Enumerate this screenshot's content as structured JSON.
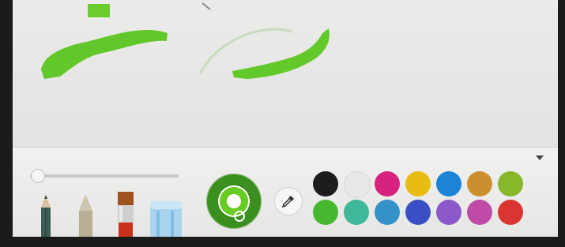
{
  "app": {
    "canvas": {
      "strokes": [
        {
          "name": "stroke-top",
          "color": "#6acd2e"
        },
        {
          "name": "stroke-left",
          "color": "#62c72a"
        },
        {
          "name": "stroke-faint-arc",
          "color": "#c8dcc0"
        },
        {
          "name": "stroke-right",
          "color": "#63c92b"
        }
      ]
    },
    "toolbar": {
      "brush_size_level": 0.05,
      "tools": [
        {
          "name": "pencil-tool",
          "icon": "pencil-icon"
        },
        {
          "name": "charcoal-tool",
          "icon": "charcoal-icon"
        },
        {
          "name": "paintbrush-tool",
          "icon": "paintbrush-icon"
        },
        {
          "name": "eraser-tool",
          "icon": "eraser-icon"
        }
      ],
      "selected_color": "#66cc22",
      "palette": [
        "#1c1c1e",
        "#e8e8e8",
        "#d8237e",
        "#e6bd10",
        "#1b84d6",
        "#cc8f2e",
        "#87b72a",
        "#46b830",
        "#3fb89a",
        "#3592c9",
        "#3b4fc4",
        "#8d58c9",
        "#c04ba6",
        "#da3531"
      ]
    }
  }
}
